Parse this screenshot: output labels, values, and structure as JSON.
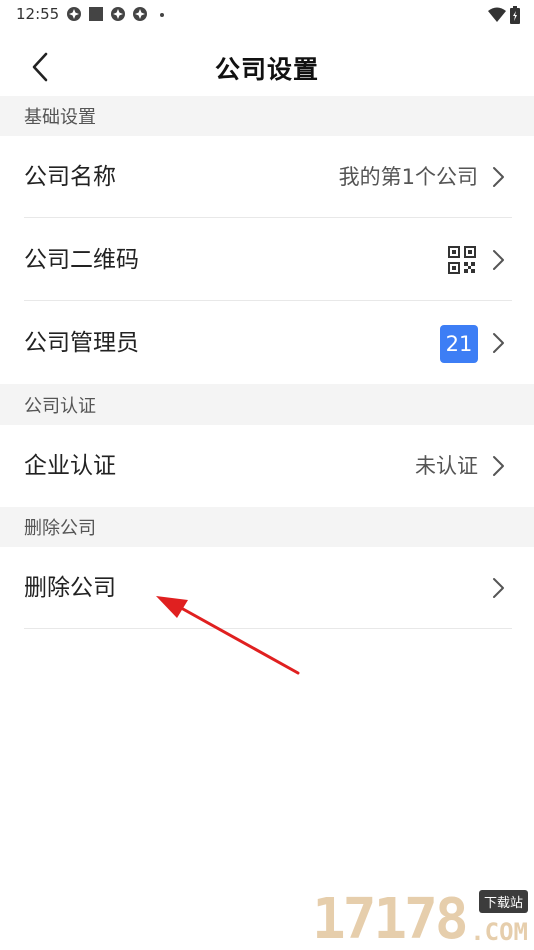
{
  "status_bar": {
    "time": "12:55",
    "left_icons": [
      "app-notification-icon",
      "square-notification-icon",
      "app-notification-icon",
      "app-notification-icon",
      "more-dot-icon"
    ],
    "right_icons": [
      "wifi-icon",
      "battery-icon"
    ]
  },
  "header": {
    "title": "公司设置",
    "back_icon": "chevron-left-icon"
  },
  "sections": [
    {
      "title": "基础设置",
      "rows": [
        {
          "label": "公司名称",
          "value": "我的第1个公司"
        },
        {
          "label": "公司二维码",
          "value_icon": "qr-code-icon"
        },
        {
          "label": "公司管理员",
          "badge": "21"
        }
      ]
    },
    {
      "title": "公司认证",
      "rows": [
        {
          "label": "企业认证",
          "value": "未认证"
        }
      ]
    },
    {
      "title": "删除公司",
      "rows": [
        {
          "label": "删除公司"
        }
      ]
    }
  ],
  "colors": {
    "accent": "#3d7ef5",
    "section_bg": "#f4f4f4",
    "annotation_arrow": "#e02020",
    "watermark": "#e4c9a4"
  },
  "watermark": {
    "digits": "17178",
    "tag": "下载站",
    "suffix": ".COM"
  }
}
